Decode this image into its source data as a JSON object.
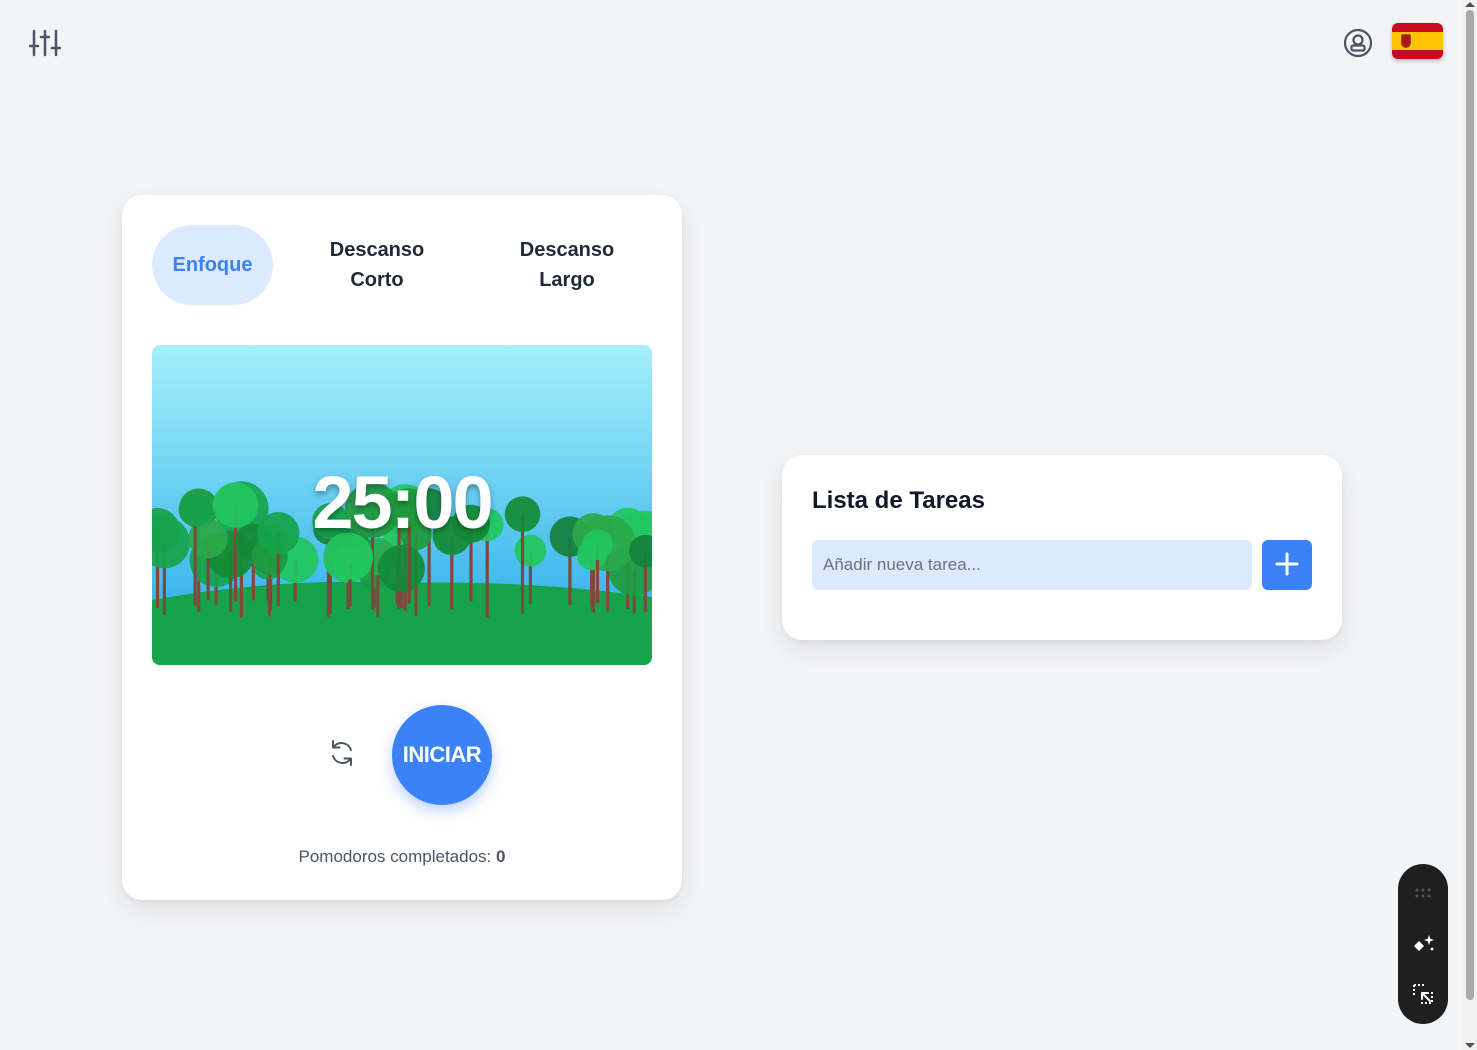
{
  "header": {
    "settings_icon": "sliders-icon",
    "account_icon": "user-circle-icon",
    "language_flag": "spain-flag"
  },
  "timer": {
    "tabs": [
      {
        "label": "Enfoque",
        "active": true
      },
      {
        "label": "Descanso Corto",
        "active": false
      },
      {
        "label": "Descanso Largo",
        "active": false
      }
    ],
    "time": "25:00",
    "start_label": "INICIAR",
    "reset_icon": "refresh-icon",
    "completed_label": "Pomodoros completados:",
    "completed_count": "0"
  },
  "tasks": {
    "title": "Lista de Tareas",
    "input_value": "",
    "input_placeholder": "Añadir nueva tarea...",
    "add_icon": "plus-icon"
  },
  "toolbar": {
    "items": [
      "grip-icon",
      "magic-icon",
      "select-icon"
    ]
  },
  "colors": {
    "accent": "#3b82f6",
    "accent_light": "#dbeafe",
    "background": "#f3f4f6",
    "sky_top": "#a5f0fb",
    "sky_bottom": "#22a7e8",
    "grass": "#16a34a"
  }
}
